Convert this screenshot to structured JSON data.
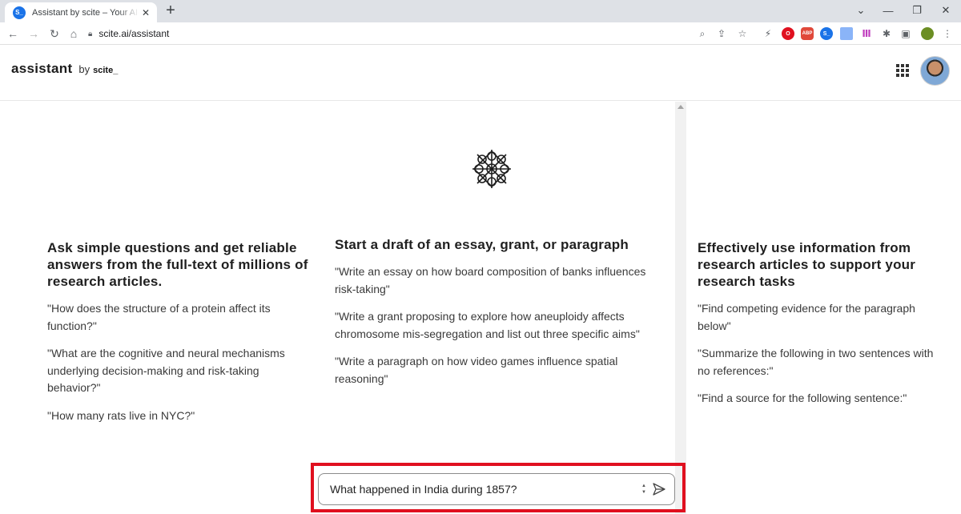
{
  "browser": {
    "tab_title": "Assistant by scite – Your AI-Powe",
    "favicon_text": "S_",
    "new_tab": "+",
    "url": "scite.ai/assistant",
    "extensions": [
      {
        "name": "opera-extension",
        "color": "#e0101f",
        "label": "O"
      },
      {
        "name": "adblock-extension",
        "color": "#e0483a",
        "label": "ABP"
      },
      {
        "name": "scite-extension",
        "color": "#1a73e8",
        "label": "S_"
      }
    ]
  },
  "header": {
    "brand_name": "assistant",
    "by": "by",
    "scite": "scite_"
  },
  "columns": [
    {
      "heading": "Ask simple questions and get reliable answers from the full-text of millions of research articles.",
      "examples": [
        "\"How does the structure of a protein affect its function?\"",
        "\"What are the cognitive and neural mechanisms underlying decision-making and risk-taking behavior?\"",
        "\"How many rats live in NYC?\""
      ]
    },
    {
      "heading": "Start a draft of an essay, grant, or paragraph",
      "examples": [
        "\"Write an essay on how board composition of banks influences risk-taking\"",
        "\"Write a grant proposing to explore how aneuploidy affects chromosome mis-segregation and list out three specific aims\"",
        "\"Write a paragraph on how video games influence spatial reasoning\""
      ]
    },
    {
      "heading": "Effectively use information from research articles to support your research tasks",
      "examples": [
        "\"Find competing evidence for the paragraph below\"",
        "\"Summarize the following in two sentences with no references:\"",
        "\"Find a source for the following sentence:\""
      ]
    }
  ],
  "query": {
    "value": "What happened in India during 1857?"
  },
  "colors": {
    "highlight": "#e0101f",
    "accent": "#1a73e8"
  }
}
